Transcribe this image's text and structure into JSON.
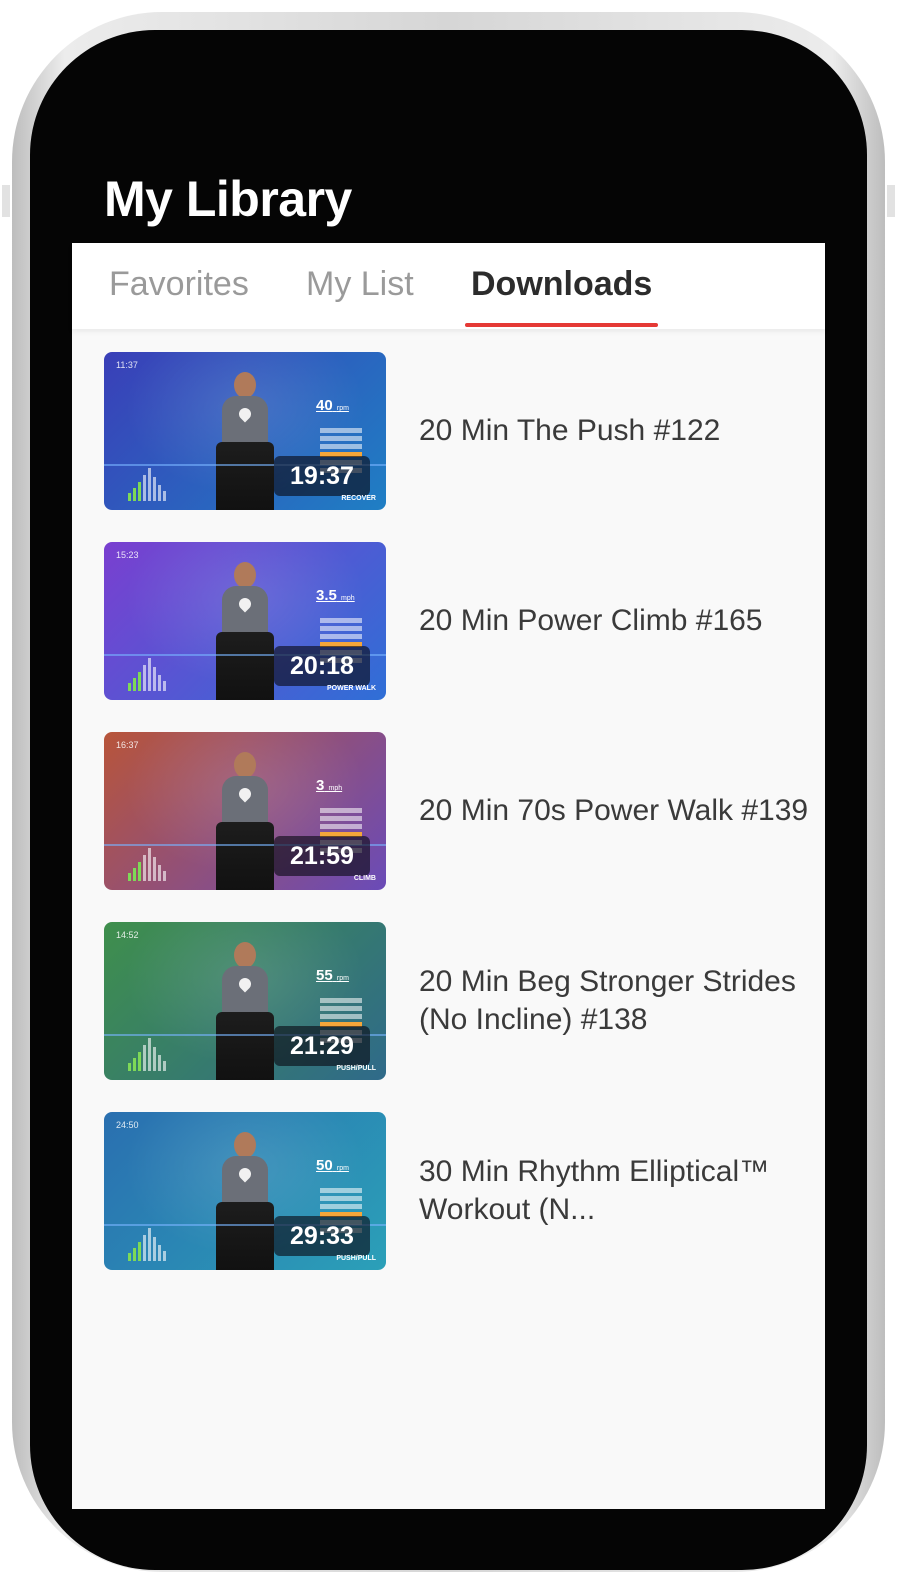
{
  "header": {
    "title": "My Library"
  },
  "tabs": [
    {
      "label": "Favorites",
      "active": false
    },
    {
      "label": "My List",
      "active": false
    },
    {
      "label": "Downloads",
      "active": true
    }
  ],
  "accent_color": "#e53935",
  "workouts": [
    {
      "title": "20 Min The Push #122",
      "duration": "19:37",
      "clock": "11:37",
      "metric_value": "40",
      "metric_unit": "rpm",
      "mode": "RECOVER",
      "thumb_colors": [
        "#3a3fb8",
        "#1f7fc4"
      ]
    },
    {
      "title": "20 Min Power Climb #165",
      "duration": "20:18",
      "clock": "15:23",
      "metric_value": "3.5",
      "metric_unit": "mph",
      "mode": "POWER WALK",
      "thumb_colors": [
        "#7a3fd0",
        "#2f6fd6"
      ]
    },
    {
      "title": "20 Min 70s Power Walk #139",
      "duration": "21:59",
      "clock": "16:37",
      "metric_value": "3",
      "metric_unit": "mph",
      "mode": "CLIMB",
      "thumb_colors": [
        "#b8553a",
        "#6a4bb8"
      ]
    },
    {
      "title": "20 Min Beg Stronger Strides (No Incline) #138",
      "duration": "21:29",
      "clock": "14:52",
      "metric_value": "55",
      "metric_unit": "rpm",
      "mode": "PUSH/PULL",
      "thumb_colors": [
        "#3f8f4c",
        "#2f6a8a"
      ]
    },
    {
      "title": "30 Min Rhythm Elliptical™ Workout (N...",
      "duration": "29:33",
      "clock": "24:50",
      "metric_value": "50",
      "metric_unit": "rpm",
      "mode": "PUSH/PULL",
      "thumb_colors": [
        "#2a6fb0",
        "#2ba0b8"
      ]
    }
  ]
}
